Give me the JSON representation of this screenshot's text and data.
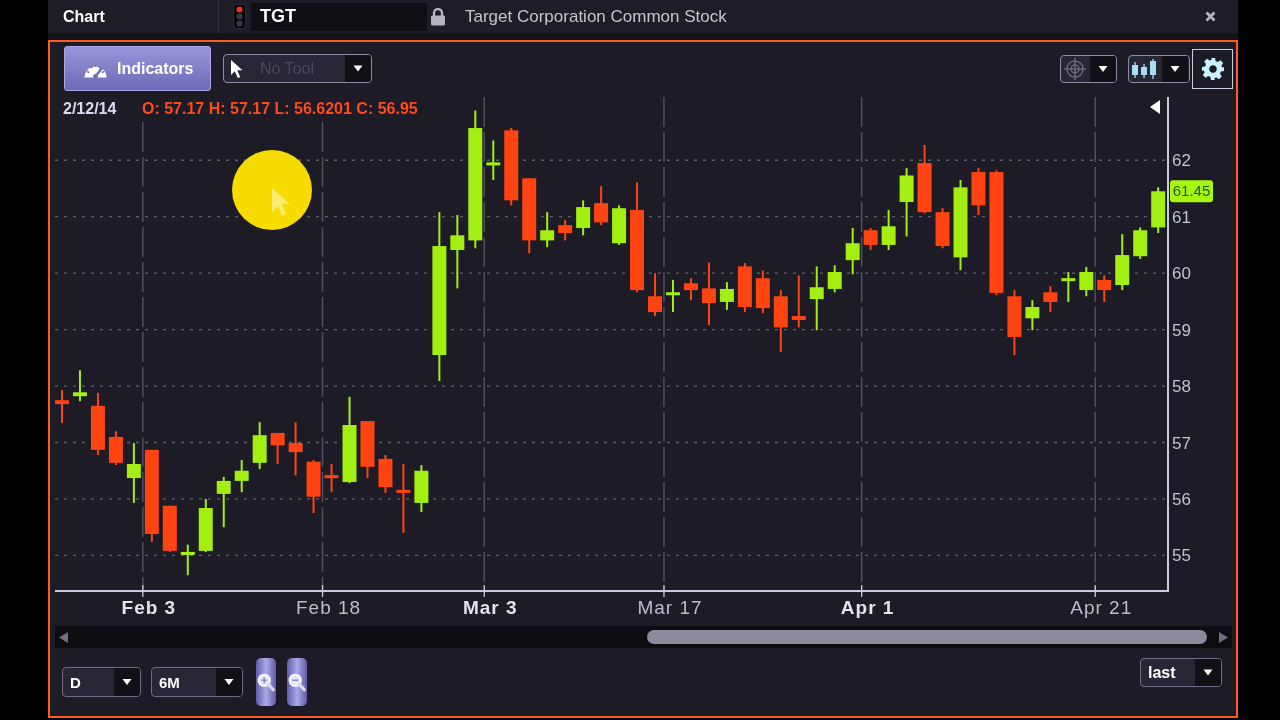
{
  "window": {
    "title": "Chart"
  },
  "symbol": {
    "ticker": "TGT",
    "name": "Target Corporation Common Stock"
  },
  "toolbar": {
    "indicators": "Indicators",
    "tool_select": {
      "value": "No Tool",
      "disabled": true
    },
    "crosshair_select": {
      "disabled": true
    }
  },
  "chart": {
    "quote_date": "2/12/14",
    "quote_ohlc": "O: 57.17 H: 57.17 L: 56.6201 C: 56.95",
    "last_price": "61.45",
    "date_label_bold": [
      true,
      false,
      true,
      false,
      true,
      false
    ],
    "chart_data": {
      "type": "candlestick",
      "categories": [
        null,
        null,
        null,
        null,
        null,
        "Feb 3",
        null,
        null,
        null,
        null,
        null,
        null,
        null,
        null,
        null,
        "Feb 18",
        null,
        null,
        null,
        null,
        null,
        null,
        null,
        null,
        "Mar 3",
        null,
        null,
        null,
        null,
        null,
        null,
        null,
        null,
        null,
        "Mar 17",
        null,
        null,
        null,
        null,
        null,
        null,
        null,
        null,
        null,
        null,
        "Apr 1",
        null,
        null,
        null,
        null,
        null,
        null,
        null,
        null,
        null,
        null,
        null,
        null,
        "Apr 21",
        null,
        null,
        null
      ],
      "ohlc": [
        [
          57.75,
          57.93,
          57.35,
          57.68
        ],
        [
          57.82,
          58.28,
          57.73,
          57.89
        ],
        [
          57.65,
          57.88,
          56.78,
          56.87
        ],
        [
          57.1,
          57.2,
          56.6,
          56.64
        ],
        [
          56.37,
          56.99,
          55.93,
          56.62
        ],
        [
          56.87,
          56.87,
          55.24,
          55.38
        ],
        [
          55.88,
          55.88,
          55.06,
          55.08
        ],
        [
          55.01,
          55.19,
          54.65,
          55.06
        ],
        [
          55.08,
          56.0,
          55.06,
          55.84
        ],
        [
          56.09,
          56.39,
          55.5,
          56.32
        ],
        [
          56.32,
          56.69,
          56.12,
          56.5
        ],
        [
          56.64,
          57.36,
          56.53,
          57.13
        ],
        [
          57.17,
          57.17,
          56.62,
          56.95
        ],
        [
          56.99,
          57.36,
          56.42,
          56.83
        ],
        [
          56.66,
          56.69,
          55.75,
          56.04
        ],
        [
          56.42,
          56.62,
          56.12,
          56.37
        ],
        [
          56.3,
          57.81,
          56.28,
          57.31
        ],
        [
          57.38,
          57.38,
          56.37,
          56.57
        ],
        [
          56.71,
          56.78,
          56.11,
          56.21
        ],
        [
          56.16,
          56.62,
          55.4,
          56.11
        ],
        [
          55.93,
          56.6,
          55.77,
          56.5
        ],
        [
          58.55,
          61.08,
          58.09,
          60.48
        ],
        [
          60.41,
          61.03,
          59.73,
          60.67
        ],
        [
          60.58,
          62.88,
          60.44,
          62.57
        ],
        [
          61.91,
          62.35,
          61.65,
          61.96
        ],
        [
          62.53,
          62.57,
          61.2,
          61.29
        ],
        [
          61.68,
          61.68,
          60.35,
          60.58
        ],
        [
          60.58,
          61.08,
          60.46,
          60.76
        ],
        [
          60.85,
          60.94,
          60.58,
          60.71
        ],
        [
          60.8,
          61.29,
          60.67,
          61.17
        ],
        [
          61.24,
          61.54,
          60.85,
          60.9
        ],
        [
          60.53,
          61.2,
          60.5,
          61.15
        ],
        [
          61.12,
          61.61,
          59.66,
          59.7
        ],
        [
          59.59,
          60.0,
          59.24,
          59.31
        ],
        [
          59.61,
          59.88,
          59.31,
          59.66
        ],
        [
          59.82,
          59.91,
          59.52,
          59.7
        ],
        [
          59.73,
          60.19,
          59.08,
          59.47
        ],
        [
          59.49,
          59.84,
          59.35,
          59.72
        ],
        [
          60.12,
          60.18,
          59.31,
          59.4
        ],
        [
          59.91,
          60.05,
          59.29,
          59.38
        ],
        [
          59.59,
          59.7,
          58.6,
          59.04
        ],
        [
          59.24,
          59.96,
          59.04,
          59.17
        ],
        [
          59.54,
          60.12,
          58.99,
          59.75
        ],
        [
          59.72,
          60.14,
          59.66,
          60.02
        ],
        [
          60.23,
          60.8,
          59.98,
          60.53
        ],
        [
          60.76,
          60.8,
          60.41,
          60.5
        ],
        [
          60.5,
          61.12,
          60.41,
          60.83
        ],
        [
          61.26,
          61.86,
          60.65,
          61.73
        ],
        [
          61.95,
          62.27,
          61.06,
          61.08
        ],
        [
          61.08,
          61.15,
          60.44,
          60.48
        ],
        [
          60.28,
          61.65,
          60.05,
          61.52
        ],
        [
          61.79,
          61.86,
          61.03,
          61.2
        ],
        [
          61.79,
          61.82,
          59.61,
          59.65
        ],
        [
          59.59,
          59.7,
          58.55,
          58.87
        ],
        [
          59.2,
          59.52,
          58.99,
          59.4
        ],
        [
          59.66,
          59.77,
          59.31,
          59.49
        ],
        [
          59.86,
          60.02,
          59.49,
          59.91
        ],
        [
          59.7,
          60.11,
          59.59,
          60.02
        ],
        [
          59.88,
          59.96,
          59.49,
          59.7
        ],
        [
          59.79,
          60.69,
          59.7,
          60.32
        ],
        [
          60.3,
          60.81,
          60.25,
          60.76
        ],
        [
          60.81,
          61.52,
          60.71,
          61.45
        ]
      ],
      "ylim": [
        54.37,
        63.12
      ],
      "yticks": [
        55,
        56,
        57,
        58,
        59,
        60,
        61,
        62
      ],
      "grid": true
    }
  },
  "footer": {
    "interval": "D",
    "range": "6M",
    "price_field": "last"
  }
}
